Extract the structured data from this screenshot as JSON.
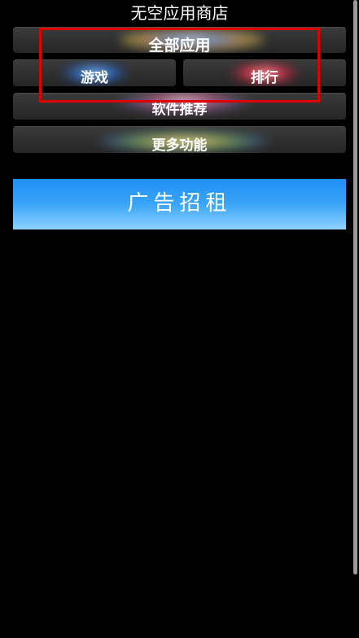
{
  "header": {
    "title": "无空应用商店"
  },
  "menu": {
    "all_apps": "全部应用",
    "games": "游戏",
    "rankings": "排行",
    "software": "软件推荐",
    "more": "更多功能"
  },
  "ad": {
    "label": "广告招租"
  },
  "colors": {
    "background": "#000000",
    "button": "#333333",
    "highlight": "#e00000",
    "ad_top": "#1f8ff5",
    "ad_bottom": "#8fd3ff",
    "scrollbar": "#9a9a9a"
  }
}
